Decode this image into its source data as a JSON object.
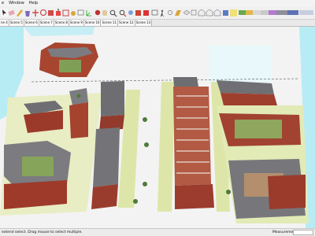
{
  "menu": {
    "items": [
      "e",
      "Window",
      "Help"
    ]
  },
  "toolbar": {
    "icons": [
      "select-icon",
      "eraser-icon",
      "pencil-icon",
      "paint-bucket-icon",
      "move-icon",
      "rotate-icon",
      "scale-icon",
      "push-pull-icon",
      "offset-icon",
      "tape-measure-icon",
      "text-icon",
      "axes-icon",
      "orbit-icon",
      "pan-icon",
      "zoom-icon",
      "zoom-extents-icon",
      "previous-view-icon",
      "3d-warehouse-icon",
      "extension-icon",
      "camera-icon",
      "walk-icon",
      "look-around-icon",
      "section-plane-icon",
      "iso-view-icon",
      "top-view-icon",
      "front-view-icon",
      "right-view-icon",
      "back-view-icon",
      "left-view-icon",
      "xray-icon",
      "wireframe-icon",
      "hidden-line-icon",
      "shaded-icon",
      "textured-icon",
      "monochrome-icon",
      "shadow-icon",
      "fog-icon"
    ]
  },
  "tabs": [
    "ne 4",
    "Scene 5",
    "Scene 6",
    "Scene 7",
    "Scene 8",
    "Scene 9",
    "Scene 10",
    "Scene 11",
    "Scene 12",
    "Scene 13"
  ],
  "status": {
    "hint": "extend select. Drag mouse to select multiple.",
    "measurements_label": "Measurements"
  },
  "colors": {
    "ground": "#f2f2f2",
    "water": "#b8ecf4",
    "lawn": "#dde6a8",
    "roof": "#7c7c80",
    "brick": "#8e3a2c"
  }
}
